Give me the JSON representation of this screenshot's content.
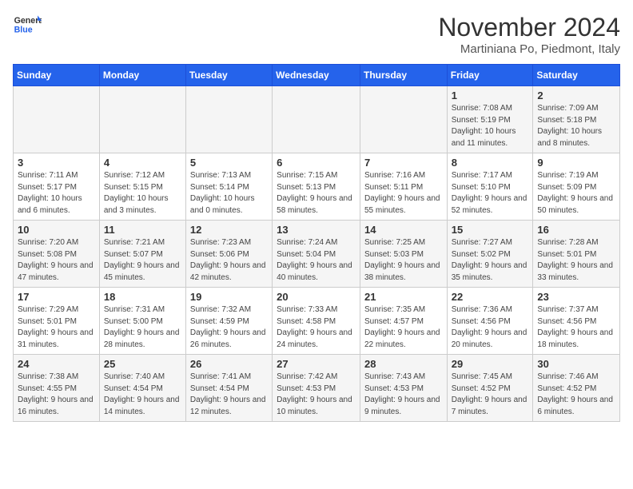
{
  "header": {
    "logo": {
      "general": "General",
      "blue": "Blue"
    },
    "title": "November 2024",
    "location": "Martiniana Po, Piedmont, Italy"
  },
  "weekdays": [
    "Sunday",
    "Monday",
    "Tuesday",
    "Wednesday",
    "Thursday",
    "Friday",
    "Saturday"
  ],
  "weeks": [
    [
      {
        "day": "",
        "info": ""
      },
      {
        "day": "",
        "info": ""
      },
      {
        "day": "",
        "info": ""
      },
      {
        "day": "",
        "info": ""
      },
      {
        "day": "",
        "info": ""
      },
      {
        "day": "1",
        "info": "Sunrise: 7:08 AM\nSunset: 5:19 PM\nDaylight: 10 hours and 11 minutes."
      },
      {
        "day": "2",
        "info": "Sunrise: 7:09 AM\nSunset: 5:18 PM\nDaylight: 10 hours and 8 minutes."
      }
    ],
    [
      {
        "day": "3",
        "info": "Sunrise: 7:11 AM\nSunset: 5:17 PM\nDaylight: 10 hours and 6 minutes."
      },
      {
        "day": "4",
        "info": "Sunrise: 7:12 AM\nSunset: 5:15 PM\nDaylight: 10 hours and 3 minutes."
      },
      {
        "day": "5",
        "info": "Sunrise: 7:13 AM\nSunset: 5:14 PM\nDaylight: 10 hours and 0 minutes."
      },
      {
        "day": "6",
        "info": "Sunrise: 7:15 AM\nSunset: 5:13 PM\nDaylight: 9 hours and 58 minutes."
      },
      {
        "day": "7",
        "info": "Sunrise: 7:16 AM\nSunset: 5:11 PM\nDaylight: 9 hours and 55 minutes."
      },
      {
        "day": "8",
        "info": "Sunrise: 7:17 AM\nSunset: 5:10 PM\nDaylight: 9 hours and 52 minutes."
      },
      {
        "day": "9",
        "info": "Sunrise: 7:19 AM\nSunset: 5:09 PM\nDaylight: 9 hours and 50 minutes."
      }
    ],
    [
      {
        "day": "10",
        "info": "Sunrise: 7:20 AM\nSunset: 5:08 PM\nDaylight: 9 hours and 47 minutes."
      },
      {
        "day": "11",
        "info": "Sunrise: 7:21 AM\nSunset: 5:07 PM\nDaylight: 9 hours and 45 minutes."
      },
      {
        "day": "12",
        "info": "Sunrise: 7:23 AM\nSunset: 5:06 PM\nDaylight: 9 hours and 42 minutes."
      },
      {
        "day": "13",
        "info": "Sunrise: 7:24 AM\nSunset: 5:04 PM\nDaylight: 9 hours and 40 minutes."
      },
      {
        "day": "14",
        "info": "Sunrise: 7:25 AM\nSunset: 5:03 PM\nDaylight: 9 hours and 38 minutes."
      },
      {
        "day": "15",
        "info": "Sunrise: 7:27 AM\nSunset: 5:02 PM\nDaylight: 9 hours and 35 minutes."
      },
      {
        "day": "16",
        "info": "Sunrise: 7:28 AM\nSunset: 5:01 PM\nDaylight: 9 hours and 33 minutes."
      }
    ],
    [
      {
        "day": "17",
        "info": "Sunrise: 7:29 AM\nSunset: 5:01 PM\nDaylight: 9 hours and 31 minutes."
      },
      {
        "day": "18",
        "info": "Sunrise: 7:31 AM\nSunset: 5:00 PM\nDaylight: 9 hours and 28 minutes."
      },
      {
        "day": "19",
        "info": "Sunrise: 7:32 AM\nSunset: 4:59 PM\nDaylight: 9 hours and 26 minutes."
      },
      {
        "day": "20",
        "info": "Sunrise: 7:33 AM\nSunset: 4:58 PM\nDaylight: 9 hours and 24 minutes."
      },
      {
        "day": "21",
        "info": "Sunrise: 7:35 AM\nSunset: 4:57 PM\nDaylight: 9 hours and 22 minutes."
      },
      {
        "day": "22",
        "info": "Sunrise: 7:36 AM\nSunset: 4:56 PM\nDaylight: 9 hours and 20 minutes."
      },
      {
        "day": "23",
        "info": "Sunrise: 7:37 AM\nSunset: 4:56 PM\nDaylight: 9 hours and 18 minutes."
      }
    ],
    [
      {
        "day": "24",
        "info": "Sunrise: 7:38 AM\nSunset: 4:55 PM\nDaylight: 9 hours and 16 minutes."
      },
      {
        "day": "25",
        "info": "Sunrise: 7:40 AM\nSunset: 4:54 PM\nDaylight: 9 hours and 14 minutes."
      },
      {
        "day": "26",
        "info": "Sunrise: 7:41 AM\nSunset: 4:54 PM\nDaylight: 9 hours and 12 minutes."
      },
      {
        "day": "27",
        "info": "Sunrise: 7:42 AM\nSunset: 4:53 PM\nDaylight: 9 hours and 10 minutes."
      },
      {
        "day": "28",
        "info": "Sunrise: 7:43 AM\nSunset: 4:53 PM\nDaylight: 9 hours and 9 minutes."
      },
      {
        "day": "29",
        "info": "Sunrise: 7:45 AM\nSunset: 4:52 PM\nDaylight: 9 hours and 7 minutes."
      },
      {
        "day": "30",
        "info": "Sunrise: 7:46 AM\nSunset: 4:52 PM\nDaylight: 9 hours and 6 minutes."
      }
    ]
  ]
}
